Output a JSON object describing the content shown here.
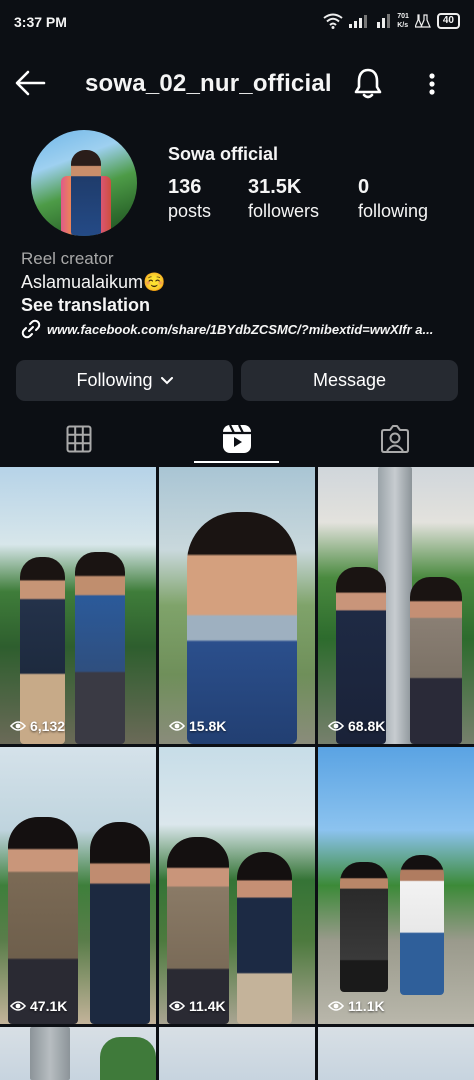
{
  "status_bar": {
    "time": "3:37 PM",
    "speed": "701\nK/s",
    "battery": "40"
  },
  "header": {
    "username": "sowa_02_nur_official"
  },
  "profile": {
    "display_name": "Sowa official",
    "stats": [
      {
        "value": "136",
        "label": "posts"
      },
      {
        "value": "31.5K",
        "label": "followers"
      },
      {
        "value": "0",
        "label": "following"
      }
    ],
    "category": "Reel creator",
    "bio": "Aslamualaikum☺️",
    "see_translation": "See translation",
    "link": "www.facebook.com/share/1BYdbZCSMC/?mibextid=wwXIfr a..."
  },
  "actions": {
    "following_label": "Following",
    "message_label": "Message"
  },
  "tabs": [
    "grid",
    "reels",
    "tagged"
  ],
  "active_tab": "reels",
  "reels": [
    {
      "views": "6,132"
    },
    {
      "views": "15.8K"
    },
    {
      "views": "68.8K"
    },
    {
      "views": "47.1K"
    },
    {
      "views": "11.4K"
    },
    {
      "views": "11.1K"
    }
  ]
}
